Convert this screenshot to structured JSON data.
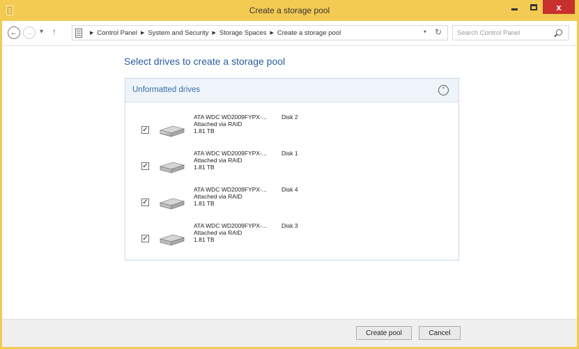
{
  "window": {
    "title": "Create a storage pool",
    "controls": {
      "minimize": "minimize-icon",
      "maximize": "maximize-icon",
      "close": "x"
    }
  },
  "address": {
    "breadcrumbs": [
      "Control Panel",
      "System and Security",
      "Storage Spaces",
      "Create a storage pool"
    ],
    "search_placeholder": "Search Control Panel"
  },
  "main": {
    "heading": "Select drives to create a storage pool",
    "panel_title": "Unformatted drives",
    "drives": [
      {
        "checked": true,
        "name": "ATA WDC WD2009FYPX-...",
        "disk": "Disk 2",
        "connection": "Attached via RAID",
        "size": "1.81 TB"
      },
      {
        "checked": true,
        "name": "ATA WDC WD2009FYPX-...",
        "disk": "Disk 1",
        "connection": "Attached via RAID",
        "size": "1.81 TB"
      },
      {
        "checked": true,
        "name": "ATA WDC WD2009FYPX-...",
        "disk": "Disk 4",
        "connection": "Attached via RAID",
        "size": "1.81 TB"
      },
      {
        "checked": true,
        "name": "ATA WDC WD2009FYPX-...",
        "disk": "Disk 3",
        "connection": "Attached via RAID",
        "size": "1.81 TB"
      }
    ]
  },
  "footer": {
    "create_label": "Create pool",
    "cancel_label": "Cancel"
  },
  "colors": {
    "frame": "#f3ca52",
    "close_button": "#c7302c",
    "heading": "#2a5aa0",
    "panel_header_bg": "#eef4fa"
  }
}
